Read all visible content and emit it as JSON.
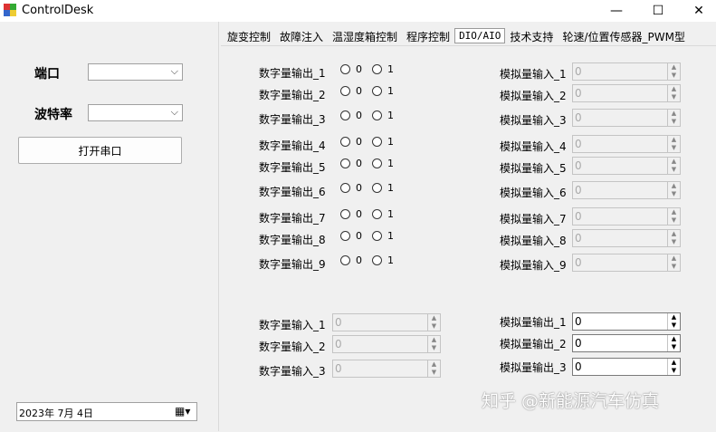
{
  "window": {
    "title": "ControlDesk",
    "minimize": "—",
    "maximize": "☐",
    "close": "✕"
  },
  "sidebar": {
    "port_label": "端口",
    "port_value": "",
    "baud_label": "波特率",
    "baud_value": "",
    "open_button": "打开串口",
    "date_value": "2023年 7月 4日"
  },
  "tabs": [
    "旋变控制",
    "故障注入",
    "温湿度箱控制",
    "程序控制",
    "DIO/AIO",
    "技术支持",
    "轮速/位置传感器_PWM型"
  ],
  "active_tab": "DIO/AIO",
  "digital_outputs": [
    {
      "label": "数字量输出_1",
      "opt0": "0",
      "opt1": "1"
    },
    {
      "label": "数字量输出_2",
      "opt0": "0",
      "opt1": "1"
    },
    {
      "label": "数字量输出_3",
      "opt0": "0",
      "opt1": "1"
    },
    {
      "label": "数字量输出_4",
      "opt0": "0",
      "opt1": "1"
    },
    {
      "label": "数字量输出_5",
      "opt0": "0",
      "opt1": "1"
    },
    {
      "label": "数字量输出_6",
      "opt0": "0",
      "opt1": "1"
    },
    {
      "label": "数字量输出_7",
      "opt0": "0",
      "opt1": "1"
    },
    {
      "label": "数字量输出_8",
      "opt0": "0",
      "opt1": "1"
    },
    {
      "label": "数字量输出_9",
      "opt0": "0",
      "opt1": "1"
    }
  ],
  "analog_inputs": [
    {
      "label": "模拟量输入_1",
      "value": "0"
    },
    {
      "label": "模拟量输入_2",
      "value": "0"
    },
    {
      "label": "模拟量输入_3",
      "value": "0"
    },
    {
      "label": "模拟量输入_4",
      "value": "0"
    },
    {
      "label": "模拟量输入_5",
      "value": "0"
    },
    {
      "label": "模拟量输入_6",
      "value": "0"
    },
    {
      "label": "模拟量输入_7",
      "value": "0"
    },
    {
      "label": "模拟量输入_8",
      "value": "0"
    },
    {
      "label": "模拟量输入_9",
      "value": "0"
    }
  ],
  "digital_inputs": [
    {
      "label": "数字量输入_1",
      "value": "0"
    },
    {
      "label": "数字量输入_2",
      "value": "0"
    },
    {
      "label": "数字量输入_3",
      "value": "0"
    }
  ],
  "analog_outputs": [
    {
      "label": "模拟量输出_1",
      "value": "0"
    },
    {
      "label": "模拟量输出_2",
      "value": "0"
    },
    {
      "label": "模拟量输出_3",
      "value": "0"
    }
  ],
  "watermark": "知乎 @新能源汽车仿真"
}
